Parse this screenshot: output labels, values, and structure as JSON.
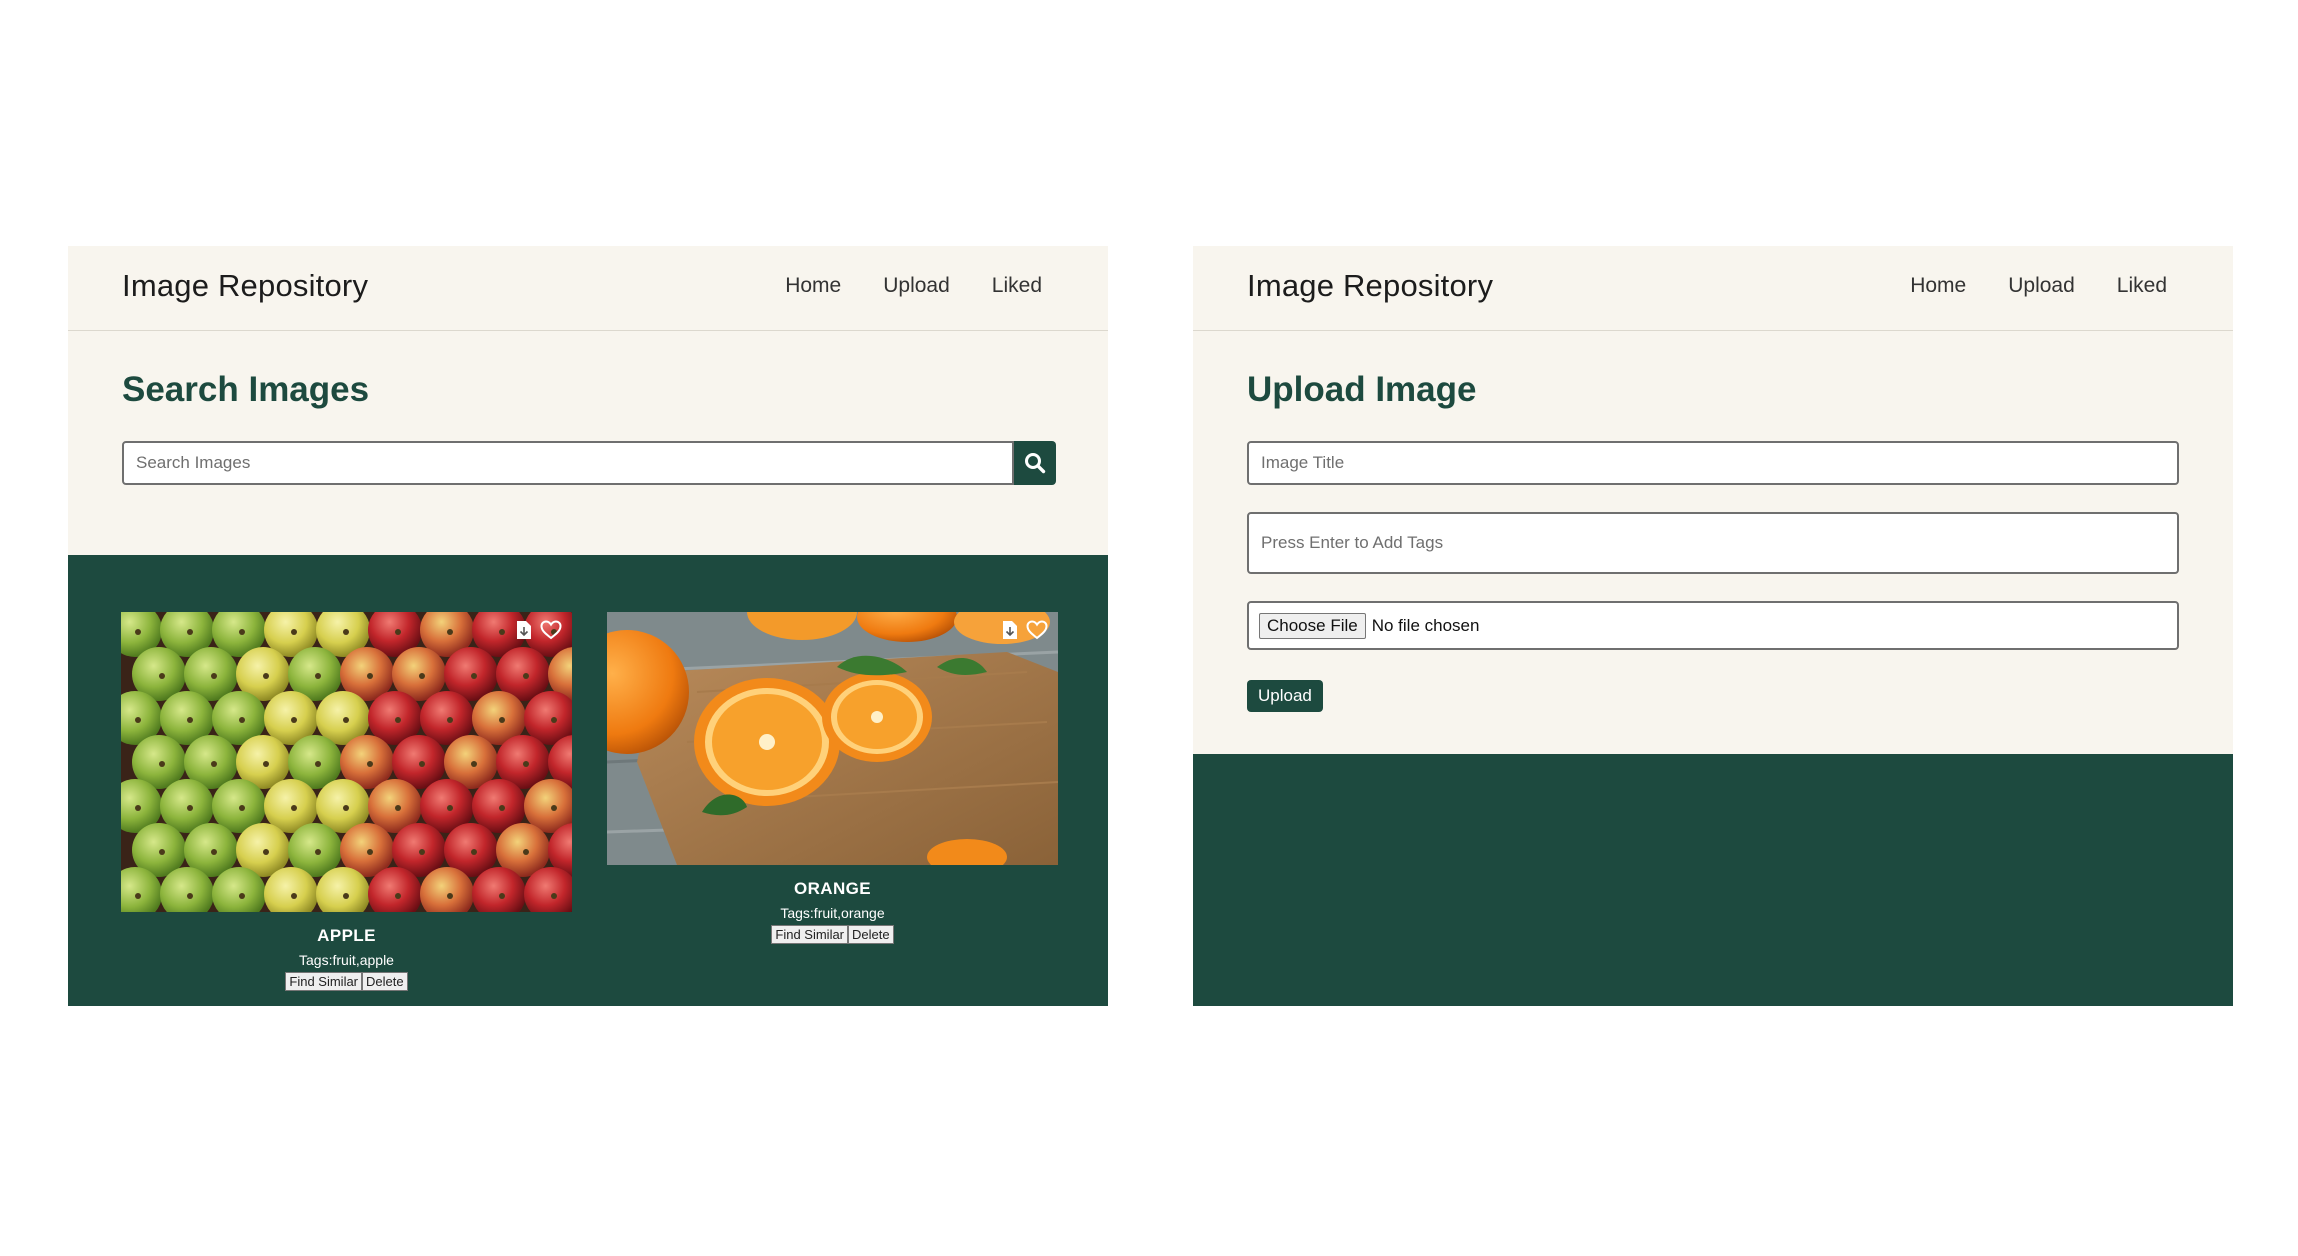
{
  "search_page": {
    "navbar": {
      "brand": "Image Repository",
      "links": [
        "Home",
        "Upload",
        "Liked"
      ]
    },
    "heading": "Search Images",
    "search": {
      "placeholder": "Search Images",
      "value": ""
    },
    "cards": [
      {
        "title": "APPLE",
        "tags": "Tags:fruit,apple",
        "find_similar_label": "Find Similar",
        "delete_label": "Delete"
      },
      {
        "title": "ORANGE",
        "tags": "Tags:fruit,orange",
        "find_similar_label": "Find Similar",
        "delete_label": "Delete"
      }
    ]
  },
  "upload_page": {
    "navbar": {
      "brand": "Image Repository",
      "links": [
        "Home",
        "Upload",
        "Liked"
      ]
    },
    "heading": "Upload Image",
    "title_field": {
      "placeholder": "Image Title",
      "value": ""
    },
    "tags_field": {
      "placeholder": "Press Enter to Add Tags",
      "value": ""
    },
    "file_input": {
      "button_label": "Choose File",
      "status": "No file chosen"
    },
    "upload_label": "Upload"
  },
  "colors": {
    "accent": "#1d4a3f",
    "panel_background": "#f8f5ee",
    "page_background": "#ffffff"
  },
  "icons": {
    "search_button": "search-icon",
    "card_download": "download-icon",
    "card_like": "heart-icon"
  }
}
